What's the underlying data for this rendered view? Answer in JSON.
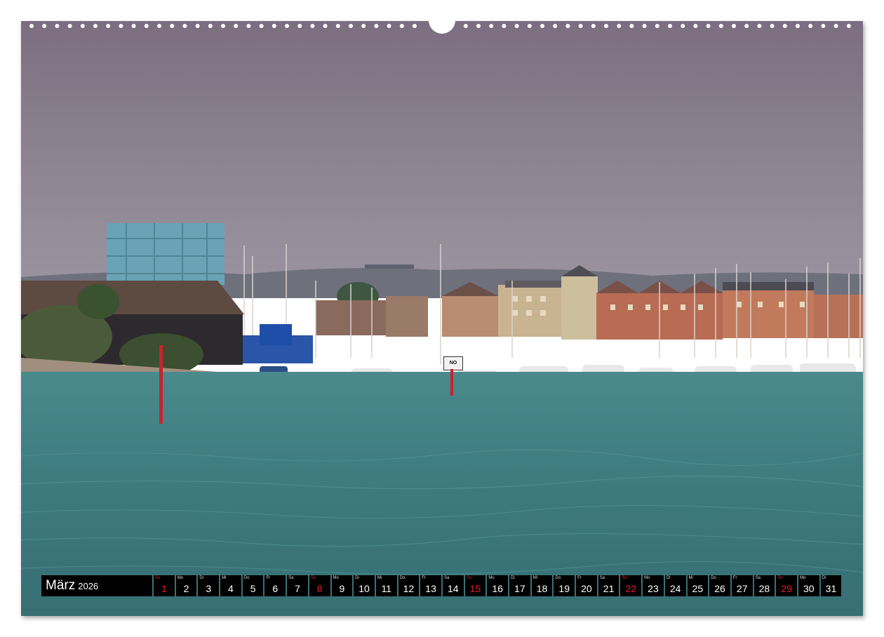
{
  "calendar": {
    "month": "März",
    "year": "2026",
    "days": [
      {
        "wd": "So",
        "d": "1",
        "sun": true
      },
      {
        "wd": "Mo",
        "d": "2"
      },
      {
        "wd": "Di",
        "d": "3"
      },
      {
        "wd": "Mi",
        "d": "4"
      },
      {
        "wd": "Do",
        "d": "5"
      },
      {
        "wd": "Fr",
        "d": "6"
      },
      {
        "wd": "Sa",
        "d": "7"
      },
      {
        "wd": "So",
        "d": "8",
        "sun": true
      },
      {
        "wd": "Mo",
        "d": "9"
      },
      {
        "wd": "Di",
        "d": "10"
      },
      {
        "wd": "Mi",
        "d": "11"
      },
      {
        "wd": "Do",
        "d": "12"
      },
      {
        "wd": "Fr",
        "d": "13"
      },
      {
        "wd": "Sa",
        "d": "14"
      },
      {
        "wd": "So",
        "d": "15",
        "sun": true
      },
      {
        "wd": "Mo",
        "d": "16"
      },
      {
        "wd": "Di",
        "d": "17"
      },
      {
        "wd": "Mi",
        "d": "18"
      },
      {
        "wd": "Do",
        "d": "19"
      },
      {
        "wd": "Fr",
        "d": "20"
      },
      {
        "wd": "Sa",
        "d": "21"
      },
      {
        "wd": "So",
        "d": "22",
        "sun": true
      },
      {
        "wd": "Mo",
        "d": "23"
      },
      {
        "wd": "Di",
        "d": "24"
      },
      {
        "wd": "Mi",
        "d": "25"
      },
      {
        "wd": "Do",
        "d": "26"
      },
      {
        "wd": "Fr",
        "d": "27"
      },
      {
        "wd": "Sa",
        "d": "28"
      },
      {
        "wd": "So",
        "d": "29",
        "sun": true
      },
      {
        "wd": "Mo",
        "d": "30"
      },
      {
        "wd": "Di",
        "d": "31"
      }
    ]
  },
  "photo": {
    "sign_text": "NO"
  },
  "colors": {
    "sky": "#8a7f8d",
    "water": "#3f7e82",
    "sunday": "#e0202a",
    "strip": "#000000"
  }
}
